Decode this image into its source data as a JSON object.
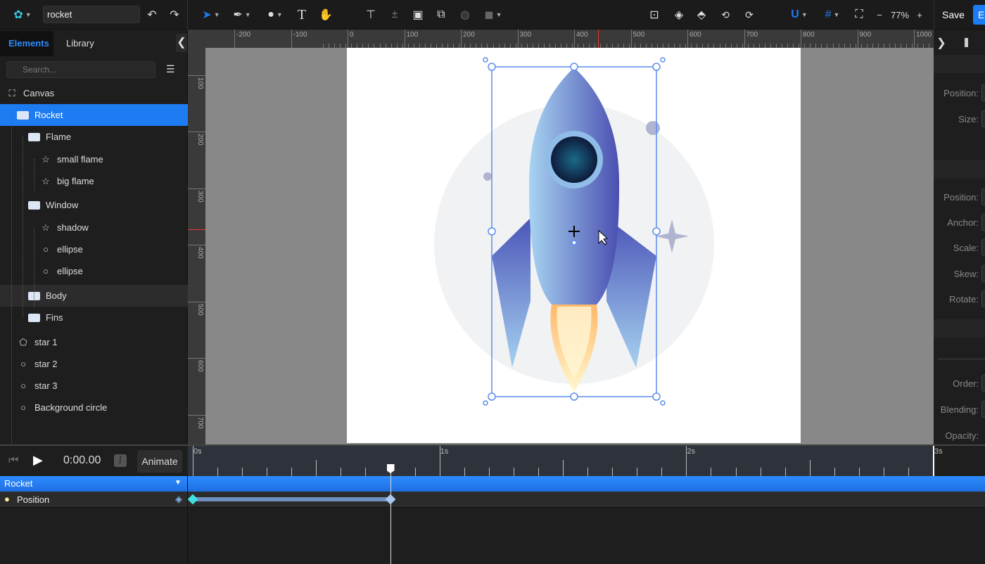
{
  "toolbar": {
    "document_name": "rocket",
    "zoom": "77%",
    "zoom_minus": "−",
    "zoom_plus": "+",
    "save_label": "Save",
    "export_label": "E",
    "tools": [
      "select-tool",
      "pen-tool",
      "shape-tool",
      "text-tool",
      "hand-tool"
    ],
    "accent": "#1e7cf2"
  },
  "left_panel": {
    "tabs": [
      {
        "label": "Elements",
        "active": true
      },
      {
        "label": "Library",
        "active": false
      }
    ],
    "search_placeholder": "Search...",
    "layers": [
      {
        "label": "Canvas",
        "icon": "canvas-icon",
        "depth": 0
      },
      {
        "label": "Rocket",
        "icon": "folder-icon",
        "depth": 1,
        "selected": true
      },
      {
        "label": "Flame",
        "icon": "folder-icon",
        "depth": 2
      },
      {
        "label": "small flame",
        "icon": "star-shape-icon",
        "depth": 3
      },
      {
        "label": "big flame",
        "icon": "star-shape-icon",
        "depth": 3
      },
      {
        "label": "Window",
        "icon": "folder-icon",
        "depth": 2
      },
      {
        "label": "shadow",
        "icon": "star-shape-icon",
        "depth": 3
      },
      {
        "label": "ellipse",
        "icon": "ellipse-icon",
        "depth": 3
      },
      {
        "label": "ellipse",
        "icon": "ellipse-icon",
        "depth": 3
      },
      {
        "label": "Body",
        "icon": "folder-icon",
        "depth": 2,
        "hovered": true
      },
      {
        "label": "Fins",
        "icon": "folder-icon",
        "depth": 2
      },
      {
        "label": "star 1",
        "icon": "pentagon-icon",
        "depth": 1
      },
      {
        "label": "star 2",
        "icon": "ellipse-icon",
        "depth": 1
      },
      {
        "label": "star 3",
        "icon": "ellipse-icon",
        "depth": 1
      },
      {
        "label": "Background circle",
        "icon": "ellipse-icon",
        "depth": 1
      }
    ]
  },
  "rulers": {
    "horizontal": [
      "-200",
      "-100",
      "0",
      "100",
      "200",
      "300",
      "400",
      "500",
      "600",
      "700",
      "800",
      "900",
      "1000"
    ],
    "vertical": [
      "100",
      "200",
      "300",
      "400",
      "500",
      "600",
      "700"
    ]
  },
  "right_panel": {
    "labels": [
      "Position:",
      "Size:",
      "Position:",
      "Anchor:",
      "Scale:",
      "Skew:",
      "Rotate:",
      "Order:",
      "Blending:",
      "Opacity:"
    ]
  },
  "timeline": {
    "time": "0:00.00",
    "animate_label": "Animate",
    "ticks": [
      "0s",
      "1s",
      "2s",
      "3s"
    ],
    "playhead_seconds": 0.8,
    "tracks": [
      {
        "label": "Rocket"
      },
      {
        "label": "Position",
        "keyframes_seconds": [
          0,
          0.8
        ]
      }
    ]
  }
}
